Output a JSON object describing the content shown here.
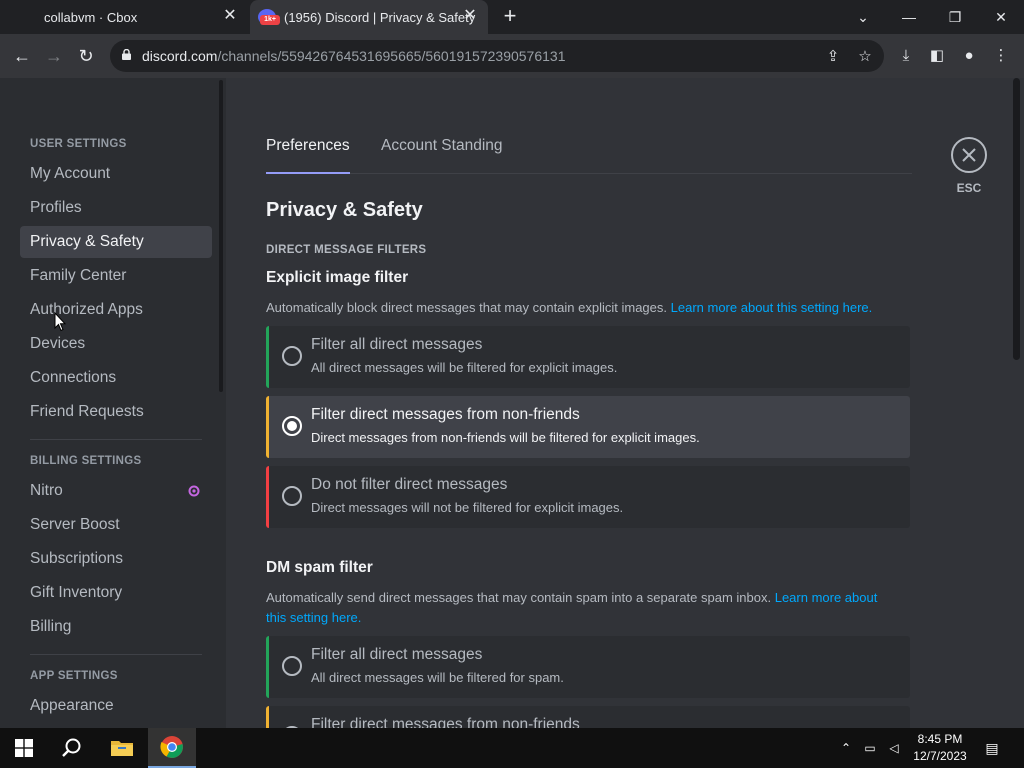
{
  "browser": {
    "tabs": [
      {
        "title": "collabvm · Cbox",
        "active": false
      },
      {
        "title": "(1956) Discord | Privacy & Safety",
        "active": true,
        "badge": "1k+"
      }
    ],
    "url_domain": "discord.com",
    "url_path": "/channels/559426764531695665/560191572390576131"
  },
  "sidebar": {
    "sections": [
      {
        "header": "USER SETTINGS",
        "items": [
          "My Account",
          "Profiles",
          "Privacy & Safety",
          "Family Center",
          "Authorized Apps",
          "Devices",
          "Connections",
          "Friend Requests"
        ]
      },
      {
        "header": "BILLING SETTINGS",
        "items": [
          "Nitro",
          "Server Boost",
          "Subscriptions",
          "Gift Inventory",
          "Billing"
        ]
      },
      {
        "header": "APP SETTINGS",
        "items": [
          "Appearance"
        ]
      }
    ],
    "selected": "Privacy & Safety"
  },
  "content": {
    "tabs": [
      "Preferences",
      "Account Standing"
    ],
    "active_tab": "Preferences",
    "close_label": "ESC",
    "title": "Privacy & Safety",
    "section_header": "DIRECT MESSAGE FILTERS",
    "explicit": {
      "title": "Explicit image filter",
      "description": "Automatically block direct messages that may contain explicit images.",
      "link": "Learn more about this setting here.",
      "options": [
        {
          "title": "Filter all direct messages",
          "subtitle": "All direct messages will be filtered for explicit images.",
          "color": "#23a55a",
          "checked": false
        },
        {
          "title": "Filter direct messages from non-friends",
          "subtitle": "Direct messages from non-friends will be filtered for explicit images.",
          "color": "#f0b232",
          "checked": true
        },
        {
          "title": "Do not filter direct messages",
          "subtitle": "Direct messages will not be filtered for explicit images.",
          "color": "#f23f43",
          "checked": false
        }
      ]
    },
    "spam": {
      "title": "DM spam filter",
      "description": "Automatically send direct messages that may contain spam into a separate spam inbox.",
      "link_part1": "Learn more about",
      "link_part2": "this setting here.",
      "options": [
        {
          "title": "Filter all direct messages",
          "subtitle": "All direct messages will be filtered for spam.",
          "color": "#23a55a",
          "checked": false
        },
        {
          "title": "Filter direct messages from non-friends",
          "subtitle": "",
          "color": "#f0b232",
          "checked": false
        }
      ]
    }
  },
  "taskbar": {
    "time": "8:45 PM",
    "date": "12/7/2023"
  },
  "colors": {
    "blurple": "#5865f2",
    "link": "#00a8fc",
    "green": "#23a55a",
    "yellow": "#f0b232",
    "red": "#f23f43"
  }
}
